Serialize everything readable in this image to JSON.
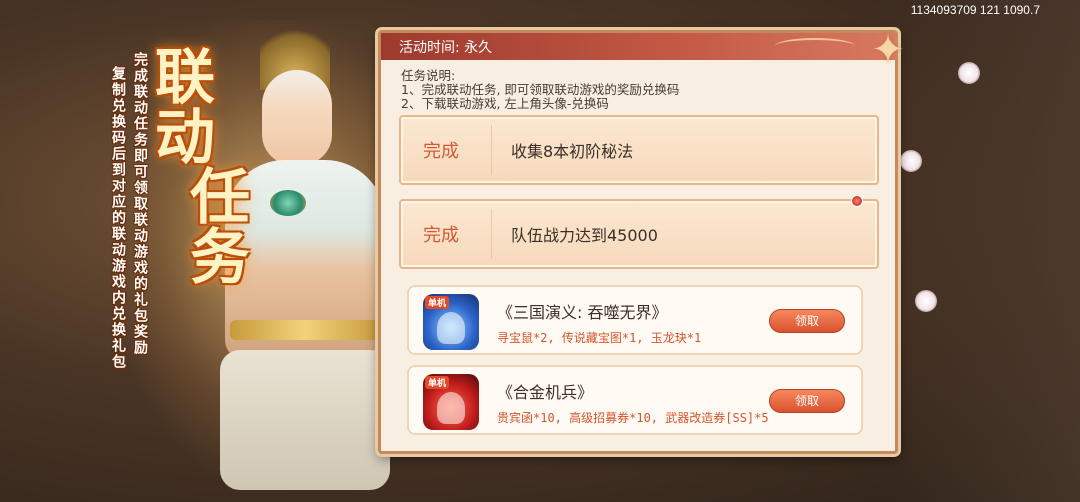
{
  "status_bar": {
    "text": "1134093709 121 1090.7"
  },
  "promo": {
    "title_line1": "联动",
    "title_line2": "任务",
    "desc_line1": "完成联动任务即可领取联动游戏的礼包奖励",
    "desc_line2": "复制兑换码后到对应的联动游戏内兑换礼包"
  },
  "panel": {
    "header": "活动时间: 永久",
    "desc": [
      "任务说明:",
      "1、完成联动任务, 即可领取联动游戏的奖励兑换码",
      "2、下载联动游戏, 左上角头像-兑换码"
    ],
    "tasks": [
      {
        "status": "完成",
        "name": "收集8本初阶秘法"
      },
      {
        "status": "完成",
        "name": "队伍战力达到45000"
      }
    ],
    "games": [
      {
        "name": "《三国演义: 吞噬无界》",
        "rewards": "寻宝鼠*2, 传说藏宝图*1, 玉龙玦*1",
        "tag": "单机",
        "button": "领取"
      },
      {
        "name": "《合金机兵》",
        "rewards": "贵宾函*10, 高级招募券*10, 武器改造券[SS]*5",
        "tag": "单机",
        "button": "领取"
      }
    ]
  },
  "colors": {
    "header_bg": "#9d3a2e",
    "done_text": "#d05a34",
    "claim_button": "#d9522e"
  },
  "icons": {
    "corner": "four-point-star-icon"
  }
}
